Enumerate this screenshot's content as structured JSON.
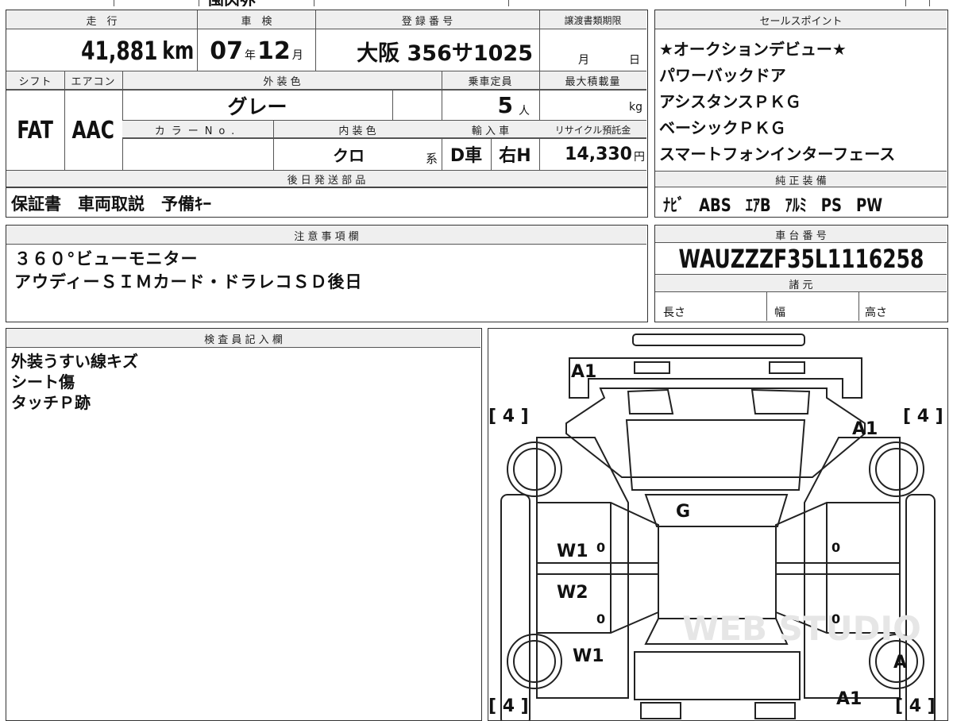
{
  "top_strip": {
    "partial_text": "国内外"
  },
  "vehicle": {
    "mileage_label": "走　行",
    "mileage": "41,881",
    "mileage_unit": "km",
    "inspection_label": "車　検",
    "inspection_year": "07",
    "inspection_year_unit": "年",
    "inspection_month": "12",
    "inspection_month_unit": "月",
    "registration_label": "登 録 番 号",
    "registration_number": "大阪 356サ1025",
    "transfer_label": "譲渡書類期限",
    "transfer_month_unit": "月",
    "transfer_day_unit": "日",
    "shift_label": "シフト",
    "shift": "FAT",
    "ac_label": "エアコン",
    "ac": "AAC",
    "exterior_color_label": "外 装 色",
    "exterior_color": "グレー",
    "color_no_label": "カラーNo.",
    "interior_color_label": "内 装 色",
    "interior_color": "クロ",
    "interior_suffix": "系",
    "capacity_label": "乗車定員",
    "capacity": "5",
    "capacity_unit": "人",
    "max_load_label": "最大積載量",
    "max_load_unit": "kg",
    "import_label": "輸 入 車",
    "import_type": "D車",
    "steering": "右H",
    "recycle_label": "リサイクル預託金",
    "recycle_fee": "14,330",
    "recycle_unit": "円"
  },
  "later_parts": {
    "label": "後 日 発 送 部 品",
    "items": "保証書　車両取説　予備ｷｰ"
  },
  "sales_points": {
    "label": "セールスポイント",
    "items": [
      "★オークションデビュー★",
      "パワーバックドア",
      "アシスタンスＰＫＧ",
      "ベーシックＰＫＧ",
      "スマートフォンインターフェース"
    ]
  },
  "equipment": {
    "label": "純 正 装 備",
    "items": "ﾅﾋﾞ　ABS　ｴｱB　ｱﾙﾐ　PS　PW"
  },
  "notes": {
    "label": "注 意 事 項 欄",
    "lines": [
      "３６０°ビューモニター",
      "アウディーＳＩＭカード・ドラレコＳＤ後日"
    ]
  },
  "chassis": {
    "label": "車 台 番 号",
    "number": "WAUZZZF35L1116258"
  },
  "specs": {
    "label": "諸 元",
    "length_label": "長さ",
    "width_label": "幅",
    "height_label": "高さ"
  },
  "inspector": {
    "label": "検 査 員 記 入 欄",
    "lines": [
      "外装うすい線キズ",
      "シート傷",
      "タッチＰ跡"
    ]
  },
  "diagram": {
    "tire_front_left": "[ 4 ]",
    "tire_front_right": "[ 4 ]",
    "tire_rear_left": "[ 4 ]",
    "tire_rear_right": "[ 4 ]",
    "mark_front_bumper": "A1",
    "mark_front_right": "A1",
    "mark_windshield": "G",
    "mark_door_fl": "W1",
    "mark_door_rl": "W2",
    "mark_rear_left": "W1",
    "mark_rear_right_wheel": "A",
    "mark_rear_right": "A1",
    "door_fl_zero": "0",
    "door_rl_zero": "0",
    "door_fr_zero": "0",
    "door_rr_zero": "0",
    "watermark": "WEB STUDIO"
  }
}
